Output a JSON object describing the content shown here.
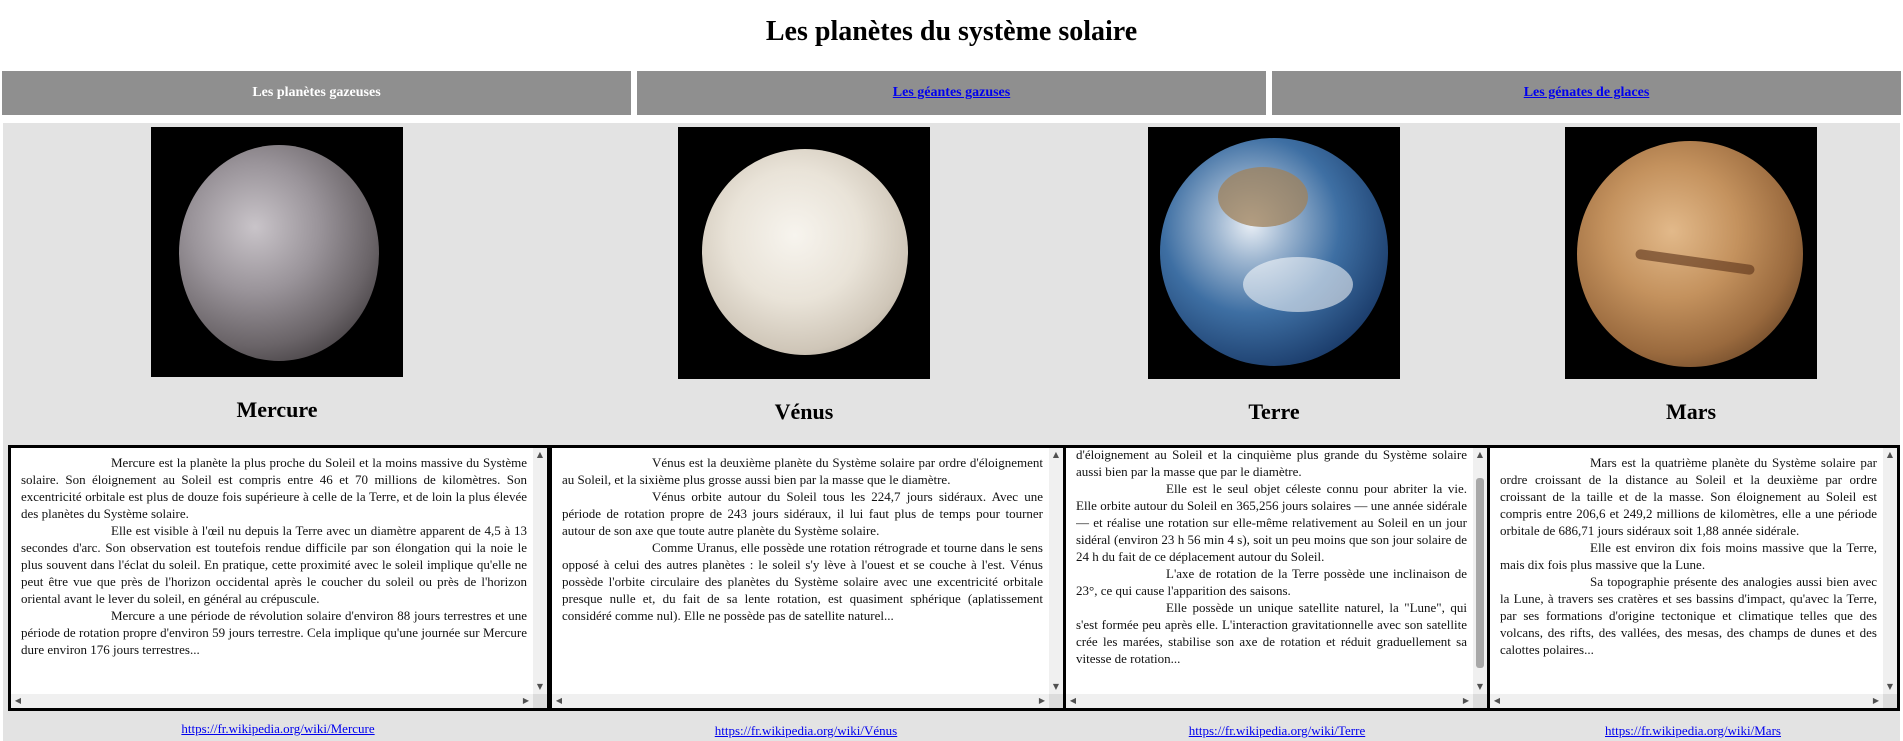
{
  "page": {
    "title": "Les planètes du système solaire"
  },
  "tabs": [
    {
      "label": "Les planètes gazeuses",
      "current": true
    },
    {
      "label": "Les géantes gazuses",
      "current": false
    },
    {
      "label": "Les génates de glaces",
      "current": false
    }
  ],
  "planets": [
    {
      "name": "Mercure",
      "paragraphs": [
        "Mercure est la planète la plus proche du Soleil et la moins massive du Système solaire. Son éloignement au Soleil est compris entre 46 et 70 millions de kilomètres. Son excentricité orbitale est plus de douze fois supérieure à celle de la Terre, et de loin la plus élevée des planètes du Système solaire.",
        "Elle est visible à l'œil nu depuis la Terre avec un diamètre apparent de 4,5 à 13 secondes d'arc. Son observation est toutefois rendue difficile par son élongation qui la noie le plus souvent dans l'éclat du soleil. En pratique, cette proximité avec le soleil implique qu'elle ne peut être vue que près de l'horizon occidental après le coucher du soleil ou près de l'horizon oriental avant le lever du soleil, en général au crépuscule.",
        "Mercure a une période de révolution solaire d'environ 88 jours terrestres et une période de rotation propre d'environ 59 jours terrestre. Cela implique qu'une journée sur Mercure dure environ 176 jours terrestres..."
      ],
      "link": "https://fr.wikipedia.org/wiki/Mercure"
    },
    {
      "name": "Vénus",
      "paragraphs": [
        "Vénus est la deuxième planète du Système solaire par ordre d'éloignement au Soleil, et la sixième plus grosse aussi bien par la masse que le diamètre.",
        "Vénus orbite autour du Soleil tous les 224,7 jours sidéraux. Avec une période de rotation propre de 243 jours sidéraux, il lui faut plus de temps pour tourner autour de son axe que toute autre planète du Système solaire.",
        "Comme Uranus, elle possède une rotation rétrograde et tourne dans le sens opposé à celui des autres planètes : le soleil s'y lève à l'ouest et se couche à l'est. Vénus possède l'orbite circulaire des planètes du Système solaire avec une excentricité orbitale presque nulle et, du fait de sa lente rotation, est quasiment sphérique (aplatissement considéré comme nul). Elle ne possède pas de satellite naturel..."
      ],
      "link": "https://fr.wikipedia.org/wiki/Vénus"
    },
    {
      "name": "Terre",
      "paragraphs": [
        "d'éloignement au Soleil et la cinquième plus grande du Système solaire aussi bien par la masse que par le diamètre.",
        "Elle est le seul objet céleste connu pour abriter la vie. Elle orbite autour du Soleil en 365,256 jours solaires — une année sidérale — et réalise une rotation sur elle-même relativement au Soleil en un jour sidéral (environ 23 h 56 min 4 s), soit un peu moins que son jour solaire de 24 h du fait de ce déplacement autour du Soleil.",
        "L'axe de rotation de la Terre possède une inclinaison de 23°, ce qui cause l'apparition des saisons.",
        "Elle possède un unique satellite naturel, la \"Lune\", qui s'est formée peu après elle. L'interaction gravitationnelle avec son satellite crée les marées, stabilise son axe de rotation et réduit graduellement sa vitesse de rotation..."
      ],
      "link": "https://fr.wikipedia.org/wiki/Terre"
    },
    {
      "name": "Mars",
      "paragraphs": [
        "Mars est la quatrième planète du Système solaire par ordre croissant de la distance au Soleil et la deuxième par ordre croissant de la taille et de la masse. Son éloignement au Soleil est compris entre 206,6 et 249,2 millions de kilomètres, elle a une période orbitale de 686,71 jours sidéraux soit 1,88 année sidérale.",
        "Elle est environ dix fois moins massive que la Terre, mais dix fois plus massive que la Lune.",
        "Sa topographie présente des analogies aussi bien avec la Lune, à travers ses cratères et ses bassins d'impact, qu'avec la Terre, par ses formations d'origine tectonique et climatique telles que des volcans, des rifts, des vallées, des mesas, des champs de dunes et des calottes polaires..."
      ],
      "link": "https://fr.wikipedia.org/wiki/Mars"
    }
  ]
}
